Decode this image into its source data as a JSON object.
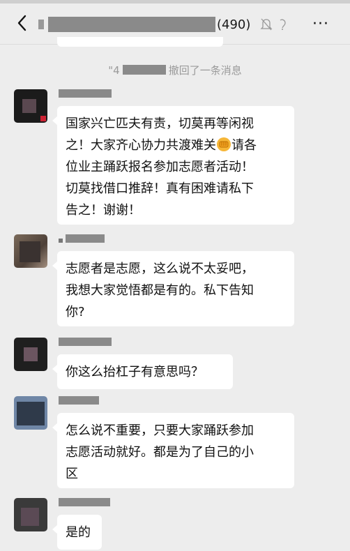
{
  "header": {
    "member_count": "(490)",
    "back_icon": "chevron-left-icon",
    "mute_icon": "bell-muted-icon",
    "more_icon": "more-icon"
  },
  "system_notice": {
    "name_prefix": "\"4",
    "recalled_text": "撤回了一条消息"
  },
  "messages": [
    {
      "text_lines": [
        "国家兴亡匹夫有责，切莫再等闲视",
        "之！大家齐心协力共渡难关",
        "位业主踊跃报名参加志愿者活动！",
        "切莫找借口推辞！真有困难请私下",
        "告之！谢谢！"
      ],
      "trailing_after_emoji": "请各",
      "emoji": "fist-emoji"
    },
    {
      "text_lines": [
        "志愿者是志愿，这么说不太妥吧，",
        "我想大家觉悟都是有的。私下告知",
        "你?"
      ]
    },
    {
      "text_lines": [
        "你这么抬杠子有意思吗？"
      ]
    },
    {
      "text_lines": [
        "怎么说不重要，只要大家踊跃参加",
        "志愿活动就好。都是为了自己的小",
        "区"
      ]
    },
    {
      "text_lines": [
        "是的"
      ]
    }
  ]
}
